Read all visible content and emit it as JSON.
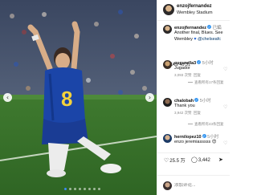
{
  "post": {
    "author": "enzojfernandez",
    "location": "Wembley Stadium",
    "caption": {
      "author": "enzojfernandez",
      "time": "已編",
      "line1": "Another final, Blues. See",
      "line2_text": "Wembley",
      "line2_tag": "@chelseafc",
      "verse": "ISAÍAS 40:31"
    },
    "jersey_number": "8",
    "carousel": {
      "slides": 8,
      "active": 0
    }
  },
  "comments": [
    {
      "user": "cucurella3",
      "time": "5小时",
      "text": "Jugador",
      "likes": "3,093 次赞",
      "reply": "回复",
      "replies_link": "查看所有17条回复",
      "avatar_color": "#c9a070"
    },
    {
      "user": "chalobah",
      "time": "5小时",
      "text": "Thank you",
      "likes": "3,942 次赞",
      "reply": "回复",
      "replies_link": "查看所有43条回复",
      "avatar_color": "#2b2b2b"
    },
    {
      "user": "hernilopez10",
      "time": "5小时",
      "text": "enzo jeremiasssss 😍",
      "likes": "",
      "reply": "",
      "replies_link": "",
      "avatar_color": "#1d3b66"
    }
  ],
  "actions": {
    "likes": "25.5 万",
    "comments": "3,442",
    "like_icon": "heart-icon",
    "comment_icon": "comment-icon",
    "share_icon": "share-icon"
  },
  "composer": {
    "placeholder": "添加评论..."
  },
  "colors": {
    "accent": "#3897f0",
    "jersey": "#1b45a8"
  }
}
